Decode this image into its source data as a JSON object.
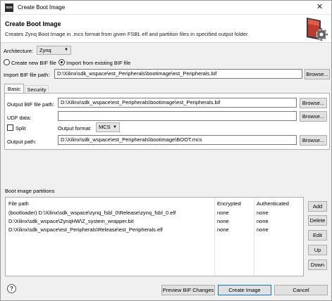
{
  "window": {
    "app_icon_text": "SDK",
    "title": "Create Boot Image",
    "close_glyph": "✕"
  },
  "header": {
    "title": "Create Boot Image",
    "description": "Creates Zynq Boot Image in .mcs format from given FSBL elf and partition files in specified output folder."
  },
  "form": {
    "architecture_label": "Architecture:",
    "architecture_value": "Zynq",
    "radio_create_new": "Create new BIF file",
    "radio_import_existing": "Import from existing BIF file",
    "import_bif_label": "Import BIF file path:",
    "import_bif_value": "D:\\Xilinx\\sdk_wspace\\est_Peripherals\\bootimage\\est_Peripherals.bif",
    "browse_label": "Browse..."
  },
  "tabs": [
    {
      "label": "Basic"
    },
    {
      "label": "Security"
    }
  ],
  "basic": {
    "output_bif_label": "Output BIF file path:",
    "output_bif_value": "D:\\Xilinx\\sdk_wspace\\est_Peripherals\\bootimage\\est_Peripherals.bif",
    "udf_label": "UDF data:",
    "udf_value": "",
    "split_label": "Split",
    "output_format_label": "Output format:",
    "output_format_value": "MCS",
    "output_path_label": "Output path:",
    "output_path_value": "D:\\Xilinx\\sdk_wspace\\est_Peripherals\\bootimage\\BOOT.mcs"
  },
  "partitions": {
    "section_label": "Boot image partitions",
    "columns": [
      "File path",
      "Encrypted",
      "Authenticated"
    ],
    "rows": [
      [
        "(bootloader) D:\\Xilinx\\sdk_wspace\\zynq_fsbl_0\\Release\\zynq_fsbl_0.elf",
        "none",
        "none"
      ],
      [
        "D:\\Xilinx\\sdk_wspace\\ZynqHW\\Z_system_wrapper.bit",
        "none",
        "none"
      ],
      [
        "D:\\Xilinx\\sdk_wspace\\est_Peripherals\\Release\\est_Peripherals.elf",
        "none",
        "none"
      ]
    ],
    "add_label": "Add",
    "delete_label": "Delete",
    "edit_label": "Edit",
    "up_label": "Up",
    "down_label": "Down"
  },
  "footer": {
    "help_glyph": "?",
    "preview_label": "Preview BIF Changes",
    "create_label": "Create Image",
    "cancel_label": "Cancel"
  }
}
